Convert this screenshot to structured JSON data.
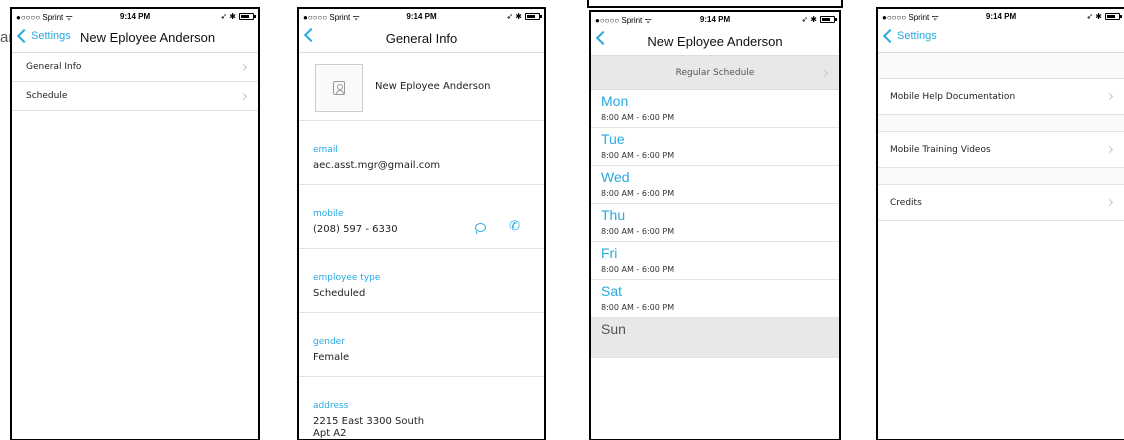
{
  "stray_text": "ari",
  "status_bar": {
    "carrier": "●○○○○ Sprint ᯤ",
    "time": "9:14 PM",
    "icons": "➶ ✱"
  },
  "accent_color": "#27a9e1",
  "screen1": {
    "back_label": "Settings",
    "title": "New Eployee Anderson",
    "items": [
      {
        "label": "General Info"
      },
      {
        "label": "Schedule"
      }
    ]
  },
  "screen2": {
    "title": "General Info",
    "employee_name": "New Eployee Anderson",
    "fields": {
      "email": {
        "label": "email",
        "value": "aec.asst.mgr@gmail.com"
      },
      "mobile": {
        "label": "mobile",
        "value": "(208) 597 - 6330"
      },
      "employee_type": {
        "label": "employee type",
        "value": "Scheduled"
      },
      "gender": {
        "label": "gender",
        "value": "Female"
      },
      "address": {
        "label": "address",
        "value": "2215 East 3300 South",
        "value_line2": "Apt A2"
      }
    }
  },
  "screen3": {
    "title": "New Eployee Anderson",
    "schedule_header": "Regular Schedule",
    "days": [
      {
        "name": "Mon",
        "hours": "8:00 AM - 6:00 PM"
      },
      {
        "name": "Tue",
        "hours": "8:00 AM - 6:00 PM"
      },
      {
        "name": "Wed",
        "hours": "8:00 AM - 6:00 PM"
      },
      {
        "name": "Thu",
        "hours": "8:00 AM - 6:00 PM"
      },
      {
        "name": "Fri",
        "hours": "8:00 AM - 6:00 PM"
      },
      {
        "name": "Sat",
        "hours": "8:00 AM - 6:00 PM"
      },
      {
        "name": "Sun",
        "hours": ""
      }
    ]
  },
  "screen4": {
    "back_label": "Settings",
    "items": [
      {
        "label": "Mobile Help Documentation"
      },
      {
        "label": "Mobile Training Videos"
      },
      {
        "label": "Credits"
      }
    ]
  }
}
